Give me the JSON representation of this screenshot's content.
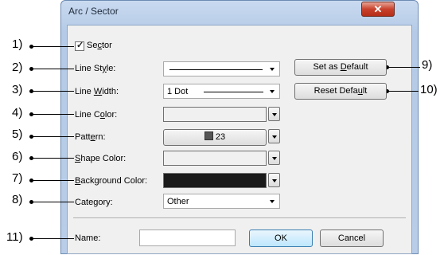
{
  "window": {
    "title": "Arc / Sector",
    "close_glyph": "✕"
  },
  "callouts": {
    "n1": "1)",
    "n2": "2)",
    "n3": "3)",
    "n4": "4)",
    "n5": "5)",
    "n6": "6)",
    "n7": "7)",
    "n8": "8)",
    "n9": "9)",
    "n10": "10)",
    "n11": "11)"
  },
  "sector": {
    "label_pre": "Se",
    "label_u": "c",
    "label_post": "tor",
    "checked": "true"
  },
  "line_style": {
    "label_pre": "Line St",
    "label_u": "y",
    "label_post": "le:"
  },
  "line_width": {
    "label_pre": "Line ",
    "label_u": "W",
    "label_post": "idth:",
    "value": "1 Dot"
  },
  "line_color": {
    "label_pre": "Line C",
    "label_u": "o",
    "label_post": "lor:",
    "color": "#ffffff"
  },
  "pattern": {
    "label_pre": "Patt",
    "label_u": "e",
    "label_post": "rn:",
    "value": "23"
  },
  "shape_color": {
    "label_u": "S",
    "label_post": "hape Color:",
    "color": "#ffffff"
  },
  "background_color": {
    "label_u": "B",
    "label_post": "ackground Color:",
    "color": "#1a1a1a"
  },
  "category": {
    "label_pre": "Cate",
    "label_u": "g",
    "label_post": "ory:",
    "value": "Other"
  },
  "set_default": {
    "pre": "Set as ",
    "u": "D",
    "post": "efault"
  },
  "reset_default": {
    "pre": "Reset Defa",
    "u": "u",
    "post": "lt"
  },
  "name": {
    "label": "Name:",
    "value": ""
  },
  "ok_label": "OK",
  "cancel_label": "Cancel"
}
